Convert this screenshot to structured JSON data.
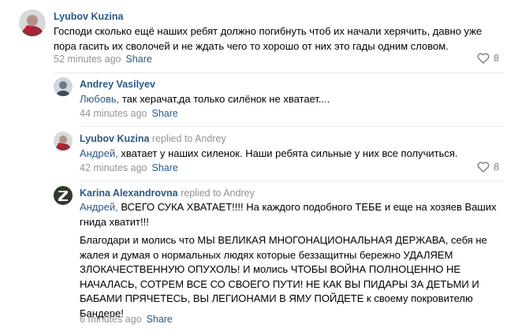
{
  "comments": [
    {
      "author": "Lyubov Kuzina",
      "replied_to": "",
      "addressee": "",
      "paragraphs": [
        "Господи сколько ещё наших ребят должно погибнуть чтоб их начали херячить, давно уже пора гасить их сволочей и не ждать чего то хорошо от них это гады одним словом."
      ],
      "time": "52 minutes ago",
      "share": "Share",
      "likes": "8"
    },
    {
      "author": "Andrey Vasilyev",
      "replied_to": "",
      "addressee": "Любовь,",
      "paragraphs": [
        " так херачат,да только силёнок не хватает...."
      ],
      "time": "44 minutes ago",
      "share": "Share",
      "likes": ""
    },
    {
      "author": "Lyubov Kuzina",
      "replied_to": "replied to Andrey",
      "addressee": "Андрей,",
      "paragraphs": [
        " хватает у наших силенок. Наши ребята сильные у них все получиться."
      ],
      "time": "42 minutes ago",
      "share": "Share",
      "likes": "8"
    },
    {
      "author": "Karina Alexandrovna",
      "replied_to": "replied to Andrey",
      "addressee": "Андрей,",
      "paragraphs": [
        " ВСЕГО СУКА ХВАТАЕТ!!!! На каждого подобного ТЕБЕ и еще на хозяев Ваших гнида хватит!!!",
        "Благодари и молись что МЫ ВЕЛИКАЯ МНОГОНАЦИОНАЛЬНАЯ ДЕРЖАВА, себя не жалея и думая о нормальных людях которые беззащитны бережно УДАЛЯЕМ ЗЛОКАЧЕСТВЕННУЮ ОПУХОЛЬ! И молись ЧТОБЫ ВОЙНА ПОЛНОЦЕННО НЕ НАЧАЛАСЬ, СОТРЕМ ВСЕ СО СВОЕГО ПУТИ! НЕ КАК ВЫ ПИДАРЫ ЗА ДЕТЬМИ И БАБАМИ ПРЯЧЕТЕСЬ, ВЫ ЛЕГИОНАМИ В ЯМУ ПОЙДЕТЕ к своему покровителю Бандере!"
      ],
      "time": "6 minutes ago",
      "share": "Share",
      "likes": ""
    }
  ],
  "icons": {
    "like": "heart-outline-icon",
    "avatar_badge": "z-letter"
  },
  "colors": {
    "link": "#2a5885",
    "muted": "#939393",
    "separator": "#e7e8ec"
  }
}
